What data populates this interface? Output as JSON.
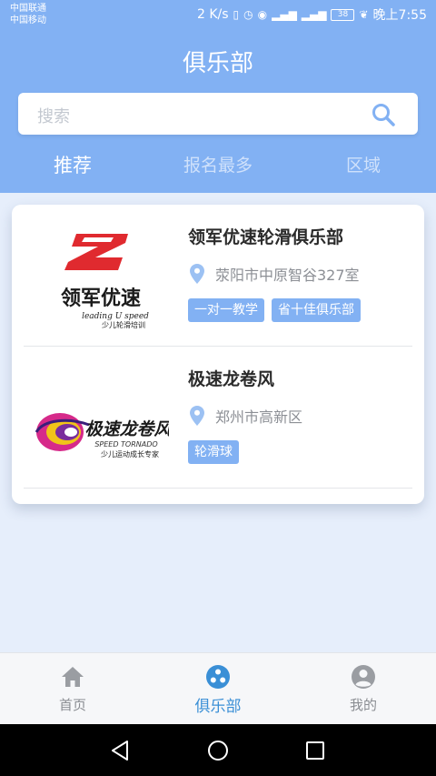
{
  "status": {
    "carrier1": "中国联通",
    "carrier2": "中国移动",
    "speed": "2 K/s",
    "battery": "38",
    "time": "晚上7:55"
  },
  "title": "俱乐部",
  "search": {
    "placeholder": "搜索"
  },
  "tabs": [
    {
      "label": "推荐",
      "active": true
    },
    {
      "label": "报名最多",
      "active": false
    },
    {
      "label": "区域",
      "active": false
    }
  ],
  "clubs": [
    {
      "name": "领军优速轮滑俱乐部",
      "address": "荥阳市中原智谷327室",
      "tags": [
        "一对一教学",
        "省十佳俱乐部"
      ],
      "logo": {
        "name": "领军优速",
        "subtitle": "leading U speed",
        "tagline": "少儿轮滑培训"
      }
    },
    {
      "name": "极速龙卷风",
      "address": "郑州市高新区",
      "tags": [
        "轮滑球"
      ],
      "logo": {
        "name": "极速龙卷风",
        "subtitle": "SPEED TORNADO",
        "tagline": "少儿运动成长专家"
      }
    }
  ],
  "nav": [
    {
      "label": "首页",
      "icon": "home-icon",
      "active": false
    },
    {
      "label": "俱乐部",
      "icon": "club-icon",
      "active": true
    },
    {
      "label": "我的",
      "icon": "profile-icon",
      "active": false
    }
  ],
  "colors": {
    "primary": "#82b1f3",
    "nav_active": "#3a8fd6",
    "background": "#e6eefb",
    "logo_red": "#e02a2f"
  }
}
